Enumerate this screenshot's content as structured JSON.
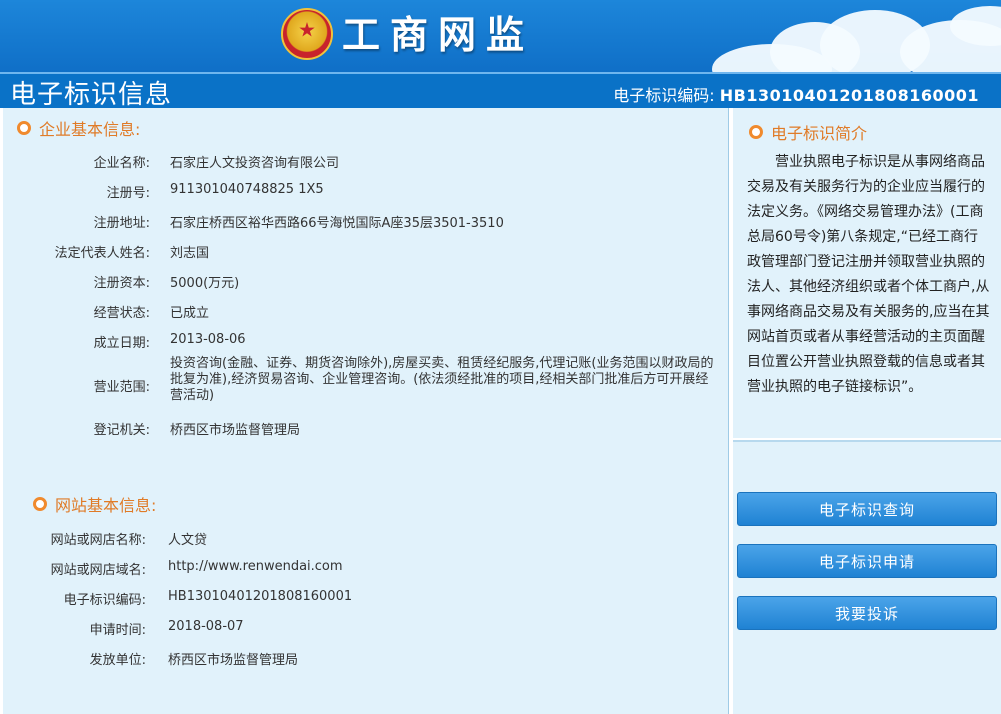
{
  "banner": {
    "title": "工商网监"
  },
  "header": {
    "page_title": "电子标识信息",
    "code_label": "电子标识编码:",
    "code_value": "HB13010401201808160001"
  },
  "enterprise": {
    "heading": "企业基本信息:",
    "rows": [
      {
        "label": "企业名称:",
        "value": "石家庄人文投资咨询有限公司"
      },
      {
        "label": "注册号:",
        "value": "911301040748825 1X5"
      },
      {
        "label": "注册地址:",
        "value": "石家庄桥西区裕华西路66号海悦国际A座35层3501-3510"
      },
      {
        "label": "法定代表人姓名:",
        "value": "刘志国"
      },
      {
        "label": "注册资本:",
        "value": "5000(万元)"
      },
      {
        "label": "经营状态:",
        "value": "已成立"
      },
      {
        "label": "成立日期:",
        "value": "2013-08-06"
      },
      {
        "label": "营业范围:",
        "value": "投资咨询(金融、证券、期货咨询除外),房屋买卖、租赁经纪服务,代理记账(业务范围以财政局的批复为准),经济贸易咨询、企业管理咨询。(依法须经批准的项目,经相关部门批准后方可开展经营活动)"
      },
      {
        "label": "登记机关:",
        "value": "桥西区市场监督管理局"
      }
    ]
  },
  "website": {
    "heading": "网站基本信息:",
    "rows": [
      {
        "label": "网站或网店名称:",
        "value": "人文贷"
      },
      {
        "label": "网站或网店域名:",
        "value": "http://www.renwendai.com"
      },
      {
        "label": "电子标识编码:",
        "value": "HB13010401201808160001"
      },
      {
        "label": "申请时间:",
        "value": "2018-08-07"
      },
      {
        "label": "发放单位:",
        "value": "桥西区市场监督管理局"
      }
    ]
  },
  "intro": {
    "heading": "电子标识简介",
    "text": "营业执照电子标识是从事网络商品交易及有关服务行为的企业应当履行的法定义务。《网络交易管理办法》(工商总局60号令)第八条规定,“已经工商行政管理部门登记注册并领取营业执照的法人、其他经济组织或者个体工商户,从事网络商品交易及有关服务的,应当在其网站首页或者从事经营活动的主页面醒目位置公开营业执照登载的信息或者其营业执照的电子链接标识”。"
  },
  "buttons": {
    "query": "电子标识查询",
    "apply": "电子标识申请",
    "complain": "我要投诉"
  },
  "colors": {
    "accent": "#e07b27",
    "primary": "#0a72c7",
    "panel": "#e1f2fb"
  }
}
